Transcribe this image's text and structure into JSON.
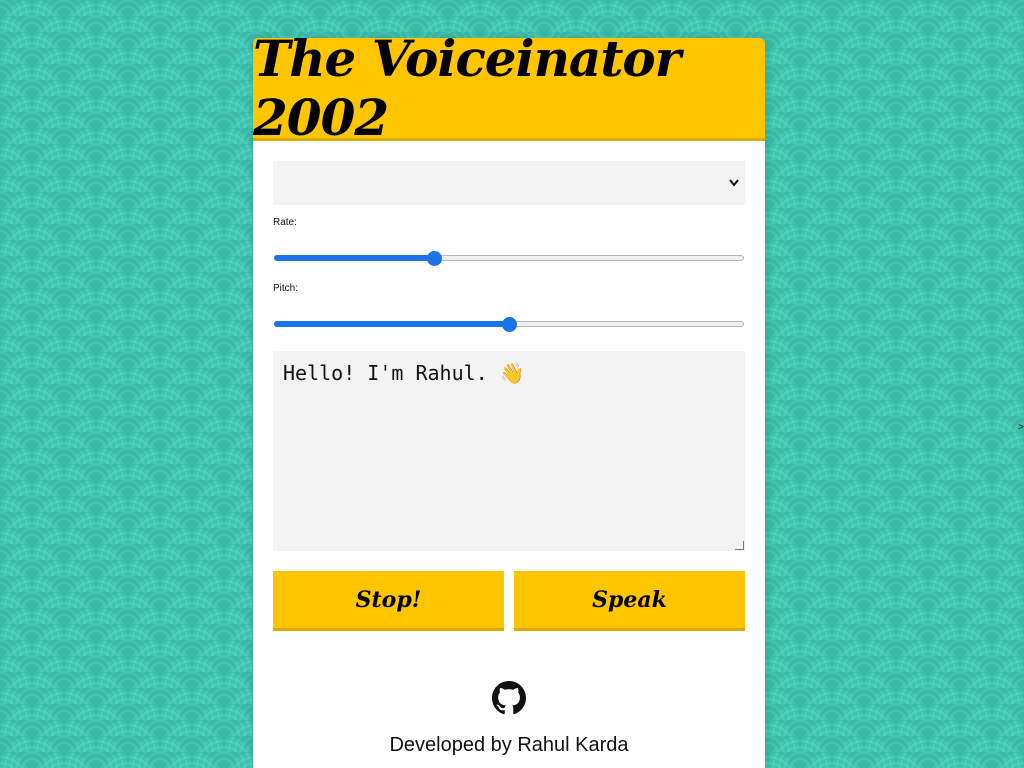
{
  "app": {
    "title": "The Voiceinator 2002"
  },
  "voice_select": {
    "selected": ""
  },
  "rate": {
    "label": "Rate:",
    "value": 0.34
  },
  "pitch": {
    "label": "Pitch:",
    "value": 0.5
  },
  "message": {
    "text": "Hello! I'm Rahul.",
    "emoji": "👋"
  },
  "buttons": {
    "stop_label": "Stop!",
    "speak_label": "Speak"
  },
  "footer": {
    "icon": "github-icon",
    "credit": "Developed by Rahul Karda"
  },
  "edge": {
    "glyph": ">"
  },
  "colors": {
    "accent": "#ffc600",
    "slider": "#1a73e8",
    "background": "#3bc4b0"
  }
}
